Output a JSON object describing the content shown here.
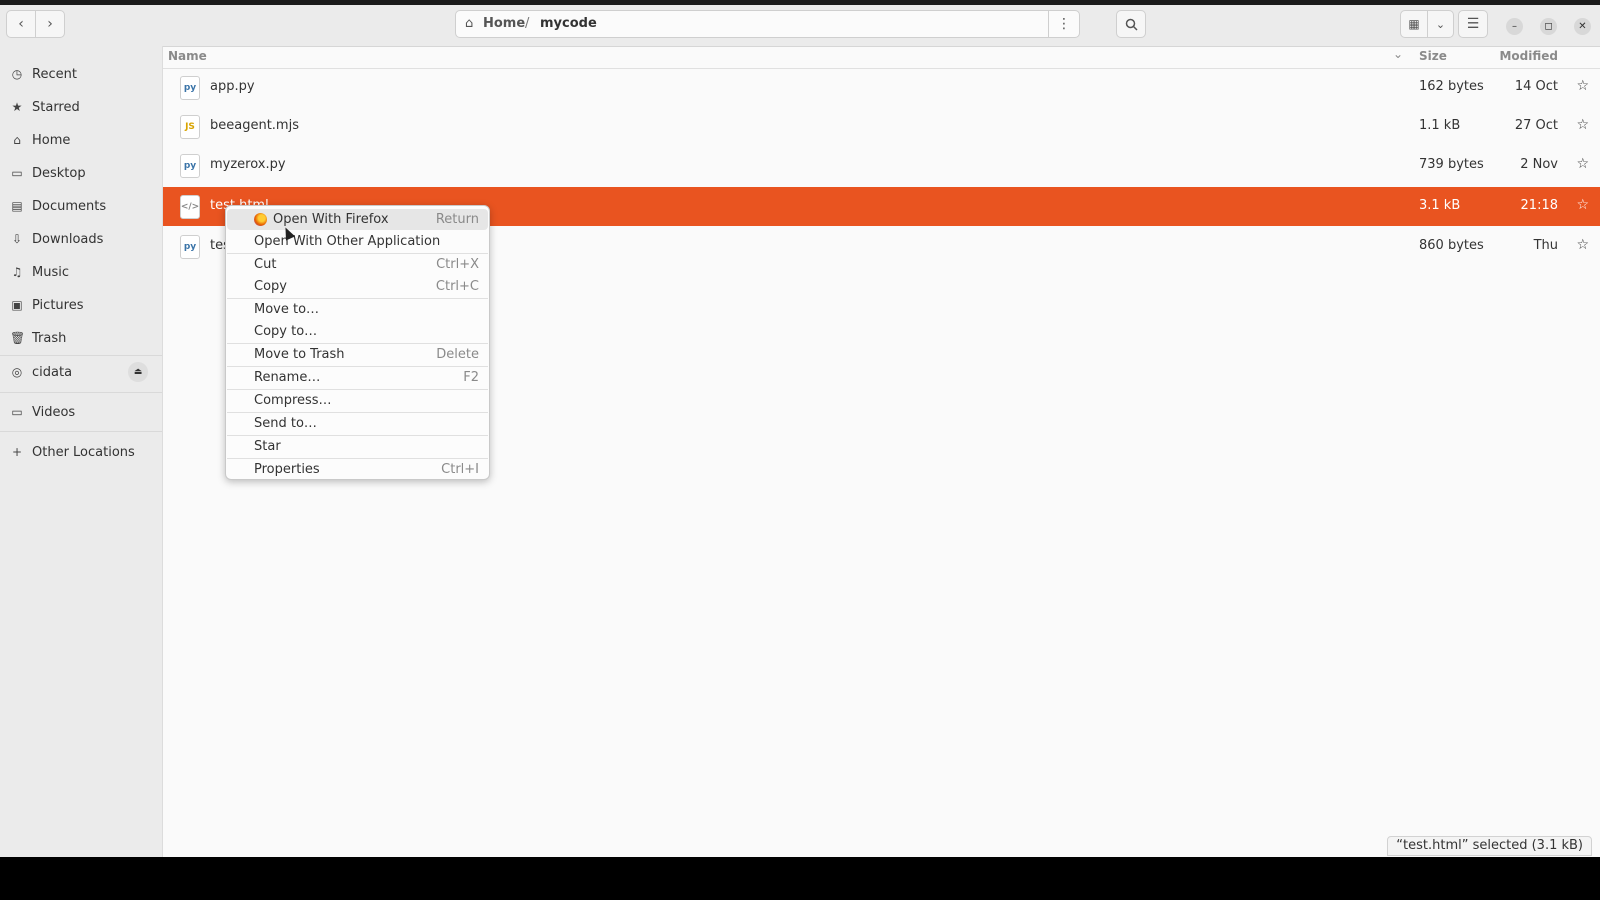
{
  "path": {
    "home": "Home",
    "current": "mycode"
  },
  "window_controls": {
    "minimize": "–",
    "maximize": "◻",
    "close": "✕"
  },
  "sidebar": {
    "items": [
      {
        "label": "Recent",
        "icon": "clock-icon"
      },
      {
        "label": "Starred",
        "icon": "star-icon"
      },
      {
        "label": "Home",
        "icon": "home-icon"
      },
      {
        "label": "Desktop",
        "icon": "desktop-icon"
      },
      {
        "label": "Documents",
        "icon": "document-icon"
      },
      {
        "label": "Downloads",
        "icon": "download-icon"
      },
      {
        "label": "Music",
        "icon": "music-icon"
      },
      {
        "label": "Pictures",
        "icon": "picture-icon"
      },
      {
        "label": "Trash",
        "icon": "trash-icon"
      }
    ],
    "drive": {
      "label": "cidata",
      "icon": "disc-icon"
    },
    "videos": {
      "label": "Videos",
      "icon": "folder-icon"
    },
    "other": {
      "label": "Other Locations",
      "icon": "plus-icon"
    }
  },
  "columns": {
    "name": "Name",
    "size": "Size",
    "modified": "Modified"
  },
  "files": [
    {
      "name": "app.py",
      "size": "162 bytes",
      "modified": "14 Oct",
      "icon": "python-file-icon"
    },
    {
      "name": "beeagent.mjs",
      "size": "1.1 kB",
      "modified": "27 Oct",
      "icon": "js-file-icon"
    },
    {
      "name": "myzerox.py",
      "size": "739 bytes",
      "modified": "2 Nov",
      "icon": "python-file-icon"
    },
    {
      "name": "test.html",
      "size": "3.1 kB",
      "modified": "21:18",
      "icon": "html-file-icon",
      "selected": true
    },
    {
      "name": "tes",
      "size": "860 bytes",
      "modified": "Thu",
      "icon": "python-file-icon"
    }
  ],
  "context_menu": {
    "items": [
      {
        "label": "Open With Firefox",
        "accel": "Return"
      },
      {
        "label": "Open With Other Application",
        "accel": ""
      },
      {
        "label": "Cut",
        "accel": "Ctrl+X"
      },
      {
        "label": "Copy",
        "accel": "Ctrl+C"
      },
      {
        "label": "Move to…",
        "accel": ""
      },
      {
        "label": "Copy to…",
        "accel": ""
      },
      {
        "label": "Move to Trash",
        "accel": "Delete"
      },
      {
        "label": "Rename…",
        "accel": "F2"
      },
      {
        "label": "Compress…",
        "accel": ""
      },
      {
        "label": "Send to…",
        "accel": ""
      },
      {
        "label": "Star",
        "accel": ""
      },
      {
        "label": "Properties",
        "accel": "Ctrl+I"
      }
    ]
  },
  "status": "“test.html” selected (3.1 kB)",
  "colors": {
    "accent": "#e95420",
    "sidebar_bg": "#ebebeb",
    "content_bg": "#fafafa"
  }
}
